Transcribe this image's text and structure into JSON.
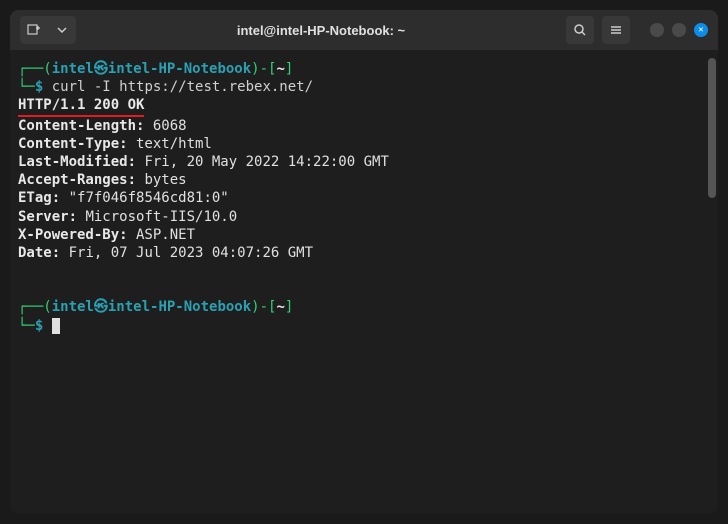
{
  "titlebar": {
    "title": "intel@intel-HP-Notebook: ~"
  },
  "prompt1": {
    "open_bracket": "┌──(",
    "user": "intel",
    "at": "㉿",
    "host": "intel-HP-Notebook",
    "close_bracket": ")-[",
    "path": "~",
    "end_bracket": "]",
    "line2_start": "└─",
    "dollar": "$",
    "command": " curl -I https://test.rebex.net/"
  },
  "response": {
    "status": "HTTP/1.1 200 OK",
    "headers": [
      {
        "key": "Content-Length:",
        "value": " 6068"
      },
      {
        "key": "Content-Type:",
        "value": " text/html"
      },
      {
        "key": "Last-Modified:",
        "value": " Fri, 20 May 2022 14:22:00 GMT"
      },
      {
        "key": "Accept-Ranges:",
        "value": " bytes"
      },
      {
        "key": "ETag:",
        "value": " \"f7f046f8546cd81:0\""
      },
      {
        "key": "Server:",
        "value": " Microsoft-IIS/10.0"
      },
      {
        "key": "X-Powered-By:",
        "value": " ASP.NET"
      },
      {
        "key": "Date:",
        "value": " Fri, 07 Jul 2023 04:07:26 GMT"
      }
    ]
  },
  "prompt2": {
    "open_bracket": "┌──(",
    "user": "intel",
    "at": "㉿",
    "host": "intel-HP-Notebook",
    "close_bracket": ")-[",
    "path": "~",
    "end_bracket": "]",
    "line2_start": "└─",
    "dollar": "$"
  }
}
